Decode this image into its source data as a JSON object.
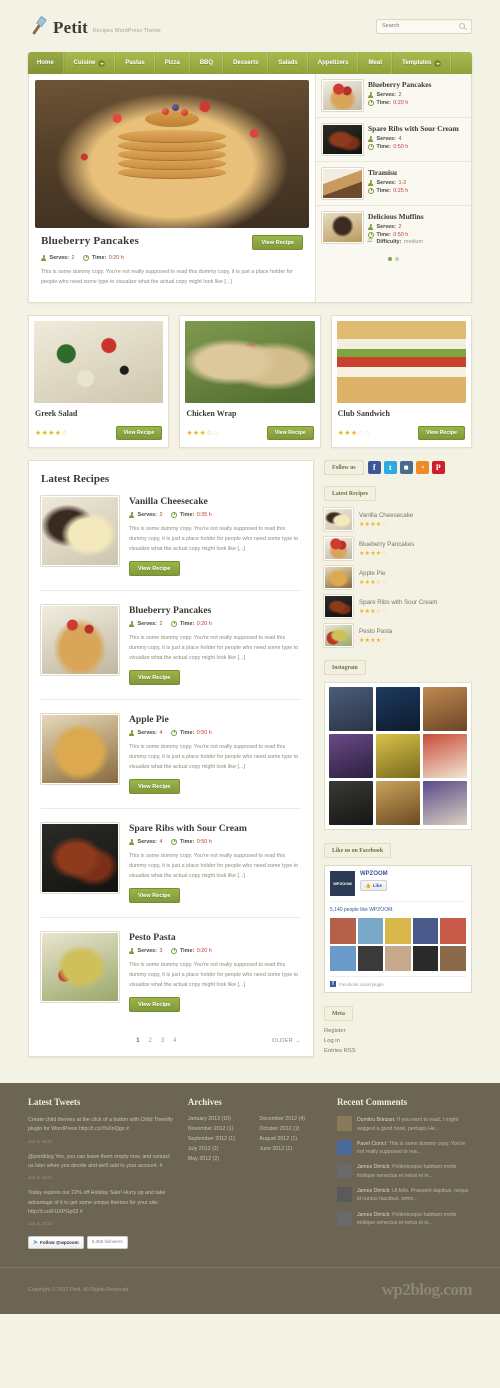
{
  "site": {
    "brand_name": "Petit",
    "tagline": "Recipes WordPress Theme"
  },
  "search": {
    "placeholder": "Search",
    "value": "",
    "icon": "search-icon"
  },
  "nav": {
    "items": [
      {
        "label": "Home",
        "active": true,
        "dropdown": false
      },
      {
        "label": "Cuisine",
        "active": false,
        "dropdown": true
      },
      {
        "label": "Pastas",
        "active": false,
        "dropdown": false
      },
      {
        "label": "Pizza",
        "active": false,
        "dropdown": false
      },
      {
        "label": "BBQ",
        "active": false,
        "dropdown": false
      },
      {
        "label": "Desserts",
        "active": false,
        "dropdown": false
      },
      {
        "label": "Salads",
        "active": false,
        "dropdown": false
      },
      {
        "label": "Appetizers",
        "active": false,
        "dropdown": false
      },
      {
        "label": "Meat",
        "active": false,
        "dropdown": false
      },
      {
        "label": "Templates",
        "active": false,
        "dropdown": true
      }
    ]
  },
  "labels": {
    "serves": "Serves:",
    "time": "Time:",
    "difficulty": "Difficulty:",
    "view_recipe": "View Recipe"
  },
  "slider": {
    "title": "Blueberry Pancakes",
    "serves": "2",
    "time": "0:20 h",
    "excerpt": "This is some dummy copy. You're not really supposed to read this dummy copy, it is just a place holder for people who need some type to visualize what the actual copy might look like [...]",
    "button": "View Recipe",
    "dots": [
      true,
      false
    ]
  },
  "featured_list": [
    {
      "title": "Blueberry Pancakes",
      "serves": "2",
      "time": "0:20 h",
      "difficulty": ""
    },
    {
      "title": "Spare Ribs with Sour Cream",
      "serves": "4",
      "time": "0:50 h",
      "difficulty": ""
    },
    {
      "title": "Tiramisu",
      "serves": "1-2",
      "time": "0:25 h",
      "difficulty": ""
    },
    {
      "title": "Delicious Muffins",
      "serves": "2",
      "time": "0:50 h",
      "difficulty": "medium"
    }
  ],
  "cards": [
    {
      "title": "Greek Salad",
      "rating": 4.5,
      "button": "View Recipe"
    },
    {
      "title": "Chicken Wrap",
      "rating": 3.5,
      "button": "View Recipe"
    },
    {
      "title": "Club Sandwich",
      "rating": 3,
      "button": "View Recipe"
    }
  ],
  "latest": {
    "title": "Latest Recipes",
    "posts": [
      {
        "title": "Vanilla Cheesecake",
        "serves": "2",
        "time": "0:35 h",
        "excerpt": "This is some dummy copy. You're not really supposed to read this dummy copy, it is just a place holder for people who need some type to visualize what the actual copy might look like [...]",
        "button": "View Recipe"
      },
      {
        "title": "Blueberry Pancakes",
        "serves": "2",
        "time": "0:20 h",
        "excerpt": "This is some dummy copy. You're not really supposed to read this dummy copy, it is just a place holder for people who need some type to visualize what the actual copy might look like [...]",
        "button": "View Recipe"
      },
      {
        "title": "Apple Pie",
        "serves": "4",
        "time": "0:50 h",
        "excerpt": "This is some dummy copy. You're not really supposed to read this dummy copy, it is just a place holder for people who need some type to visualize what the actual copy might look like [...]",
        "button": "View Recipe"
      },
      {
        "title": "Spare Ribs with Sour Cream",
        "serves": "4",
        "time": "0:50 h",
        "excerpt": "This is some dummy copy. You're not really supposed to read this dummy copy, it is just a place holder for people who need some type to visualize what the actual copy might look like [...]",
        "button": "View Recipe"
      },
      {
        "title": "Pesto Pasta",
        "serves": "3",
        "time": "0:20 h",
        "excerpt": "This is some dummy copy. You're not really supposed to read this dummy copy, it is just a place holder for people who need some type to visualize what the actual copy might look like [...]",
        "button": "View Recipe"
      }
    ],
    "pagination": {
      "pages": [
        "1",
        "2",
        "3",
        "4"
      ],
      "current": "1",
      "older": "OLDER →"
    }
  },
  "sidebar": {
    "follow_label": "Follow us",
    "socials": [
      {
        "name": "facebook",
        "glyph": "f",
        "color": "#3b5998"
      },
      {
        "name": "twitter",
        "glyph": "t",
        "color": "#2daae1"
      },
      {
        "name": "flickr",
        "glyph": "■",
        "color": "#4a6b8a"
      },
      {
        "name": "rss",
        "glyph": "◔",
        "color": "#f08a24"
      },
      {
        "name": "pinterest",
        "glyph": "P",
        "color": "#cb2027"
      }
    ],
    "latest_recipes": {
      "title": "Latest Recipes",
      "items": [
        {
          "title": "Vanilla Cheesecake",
          "rating": 4
        },
        {
          "title": "Blueberry Pancakes",
          "rating": 4
        },
        {
          "title": "Apple Pie",
          "rating": 3.5
        },
        {
          "title": "Spare Ribs with Sour Cream",
          "rating": 3.5
        },
        {
          "title": "Pesto Pasta",
          "rating": 4
        }
      ]
    },
    "instagram": {
      "title": "Instagram",
      "cells": 9
    },
    "facebook": {
      "title": "Like us on Facebook",
      "page_name": "WPZOOM",
      "logo_text": "WPZOOM",
      "like_button": "Like",
      "count_text_prefix": "5,140 people like ",
      "count_text_name": "WPZOOM",
      "count_text_suffix": ".",
      "footer": "Facebook social plugin"
    },
    "meta": {
      "title": "Meta",
      "links": [
        "Register",
        "Log in",
        "Entries RSS"
      ]
    }
  },
  "footer": {
    "tweets": {
      "title": "Latest Tweets",
      "items": [
        {
          "text": "Create child themes at the click of a button with Child Themify plugin for WordPress http://t.co/YuXnQgz #",
          "date": "Jan 3, 2013"
        },
        {
          "text": "@pontblog Yes, you can leave them empty now, and contact us later when you decide and we'll add to your account. #",
          "date": "Jan 3, 2013"
        },
        {
          "text": "Today expires our 22% off Holiday Sale! Hurry up and take advantage of it to get some unique themes for your site: http://t.co/FUXPGp03 #",
          "date": "Jan 3, 2013"
        }
      ],
      "follow_button": "Follow @wpzoom",
      "follower_count": "8,368 followers"
    },
    "archives": {
      "title": "Archives",
      "items": [
        "January 2013 (10)",
        "December 2012 (4)",
        "November 2012 (1)",
        "October 2012 (1)",
        "September 2012 (1)",
        "August 2012 (1)",
        "July 2012 (2)",
        "June 2012 (1)",
        "May 2012 (2)"
      ]
    },
    "recent_comments": {
      "title": "Recent Comments",
      "items": [
        {
          "author": "Dumitru Brinzan:",
          "text": " If you want to read, I might suggest a good book, perhaps He..."
        },
        {
          "author": "Pavel Ciorici:",
          "text": " This is some dummy copy. You're not really supposed to rea..."
        },
        {
          "author": "James Dimick:",
          "text": " Pellentesque habitant morbi tristique senectus et netus et in..."
        },
        {
          "author": "James Dimick:",
          "text": " Ut felis. Praesent dapibus, neque id cursus faucibus, tortor..."
        },
        {
          "author": "James Dimick:",
          "text": " Pellentesque habitant morbi tristique senectus et netus et in..."
        }
      ]
    },
    "copyright": "Copyright © 2013 Petit. All Rights Reserved.",
    "watermark": "wp2blog.com"
  }
}
